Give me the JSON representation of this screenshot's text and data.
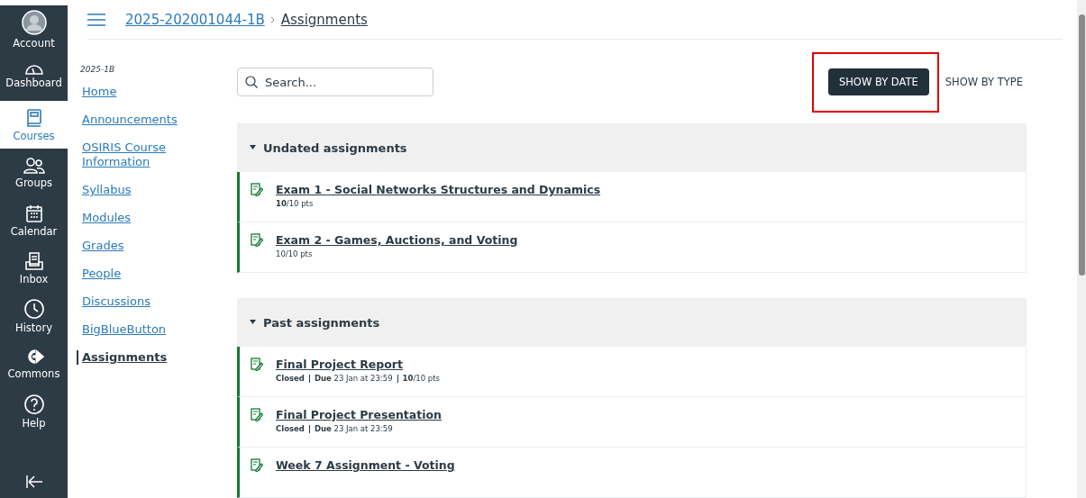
{
  "global_nav": [
    {
      "label": "Account",
      "selected": false
    },
    {
      "label": "Dashboard",
      "selected": false
    },
    {
      "label": "Courses",
      "selected": true
    },
    {
      "label": "Groups",
      "selected": false
    },
    {
      "label": "Calendar",
      "selected": false
    },
    {
      "label": "Inbox",
      "selected": false
    },
    {
      "label": "History",
      "selected": false
    },
    {
      "label": "Commons",
      "selected": false
    },
    {
      "label": "Help",
      "selected": false
    }
  ],
  "breadcrumb": [
    "2025-202001044-1B",
    "Assignments"
  ],
  "course_nav": {
    "term": "2025-1B",
    "items": [
      {
        "label": "Home",
        "selected": false
      },
      {
        "label": "Announcements",
        "selected": false
      },
      {
        "label": "OSIRIS Course Information",
        "selected": false
      },
      {
        "label": "Syllabus",
        "selected": false
      },
      {
        "label": "Modules",
        "selected": false
      },
      {
        "label": "Grades",
        "selected": false
      },
      {
        "label": "People",
        "selected": false
      },
      {
        "label": "Discussions",
        "selected": false
      },
      {
        "label": "BigBlueButton",
        "selected": false
      },
      {
        "label": "Assignments",
        "selected": true
      }
    ]
  },
  "search": {
    "placeholder": "Search..."
  },
  "view_toggle": [
    {
      "label": "SHOW BY DATE",
      "selected": true,
      "highlighted": true
    },
    {
      "label": "SHOW BY TYPE",
      "selected": false,
      "highlighted": false
    }
  ],
  "groups": [
    {
      "title": "Undated assignments",
      "expanded": true,
      "items": [
        {
          "title": "Exam 1 - Social Networks Structures and Dynamics",
          "meta": [
            "**10**/10 pts"
          ]
        },
        {
          "title": "Exam 2 - Games, Auctions, and Voting",
          "meta": [
            "10/10 pts"
          ]
        }
      ]
    },
    {
      "title": "Past assignments",
      "expanded": true,
      "items": [
        {
          "title": "Final Project Report",
          "meta": [
            "**Closed**",
            "**Due** 23 Jan at 23:59",
            "**10**/10 pts"
          ]
        },
        {
          "title": "Final Project Presentation",
          "meta": [
            "**Closed**",
            "**Due** 23 Jan at 23:59"
          ]
        },
        {
          "title": "Week 7 Assignment - Voting"
        }
      ]
    }
  ]
}
